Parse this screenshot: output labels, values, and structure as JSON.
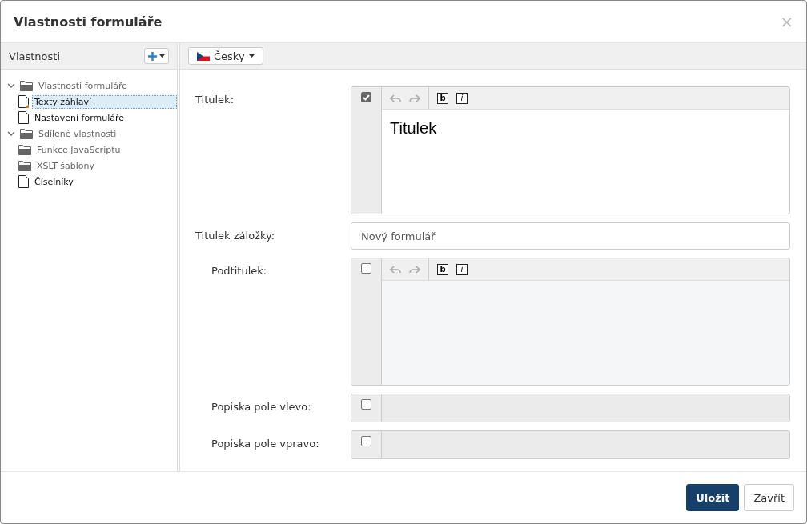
{
  "dialog": {
    "title": "Vlastnosti formuláře",
    "close": "×"
  },
  "sidebar": {
    "title": "Vlastnosti"
  },
  "tree": [
    {
      "label": "Vlastnosti formuláře",
      "kind": "folder",
      "expanded": true,
      "selected": false,
      "children": [
        {
          "label": "Texty záhlaví",
          "kind": "file",
          "selected": true,
          "modified": true
        },
        {
          "label": "Nastavení formuláře",
          "kind": "file",
          "selected": false,
          "modified": false
        }
      ]
    },
    {
      "label": "Sdílené vlastnosti",
      "kind": "folder",
      "expanded": true,
      "selected": false,
      "children": [
        {
          "label": "Funkce JavaScriptu",
          "kind": "folder",
          "selected": false
        },
        {
          "label": "XSLT šablony",
          "kind": "folder",
          "selected": false
        },
        {
          "label": "Číselníky",
          "kind": "file",
          "selected": false,
          "modified": false
        }
      ]
    }
  ],
  "language": {
    "label": "Česky"
  },
  "fields": [
    {
      "kind": "rich",
      "label": "Titulek:",
      "indented": false,
      "checked": true,
      "value": "Titulek",
      "format_buttons": [
        {
          "label": "b"
        },
        {
          "label": "i"
        }
      ]
    },
    {
      "kind": "text",
      "label": "Titulek záložky:",
      "indented": false,
      "value": "Nový formulář"
    },
    {
      "kind": "rich",
      "label": "Podtitulek:",
      "indented": true,
      "checked": false,
      "format_buttons": [
        {
          "label": "b"
        },
        {
          "label": "i"
        }
      ]
    },
    {
      "kind": "toggle",
      "label": "Popiska pole vlevo:",
      "indented": true,
      "checked": false
    },
    {
      "kind": "toggle",
      "label": "Popiska pole vpravo:",
      "indented": true,
      "checked": false
    }
  ],
  "buttons": [
    {
      "label": "Uložit",
      "kind": "primary"
    },
    {
      "label": "Zavřít",
      "kind": "default"
    }
  ]
}
